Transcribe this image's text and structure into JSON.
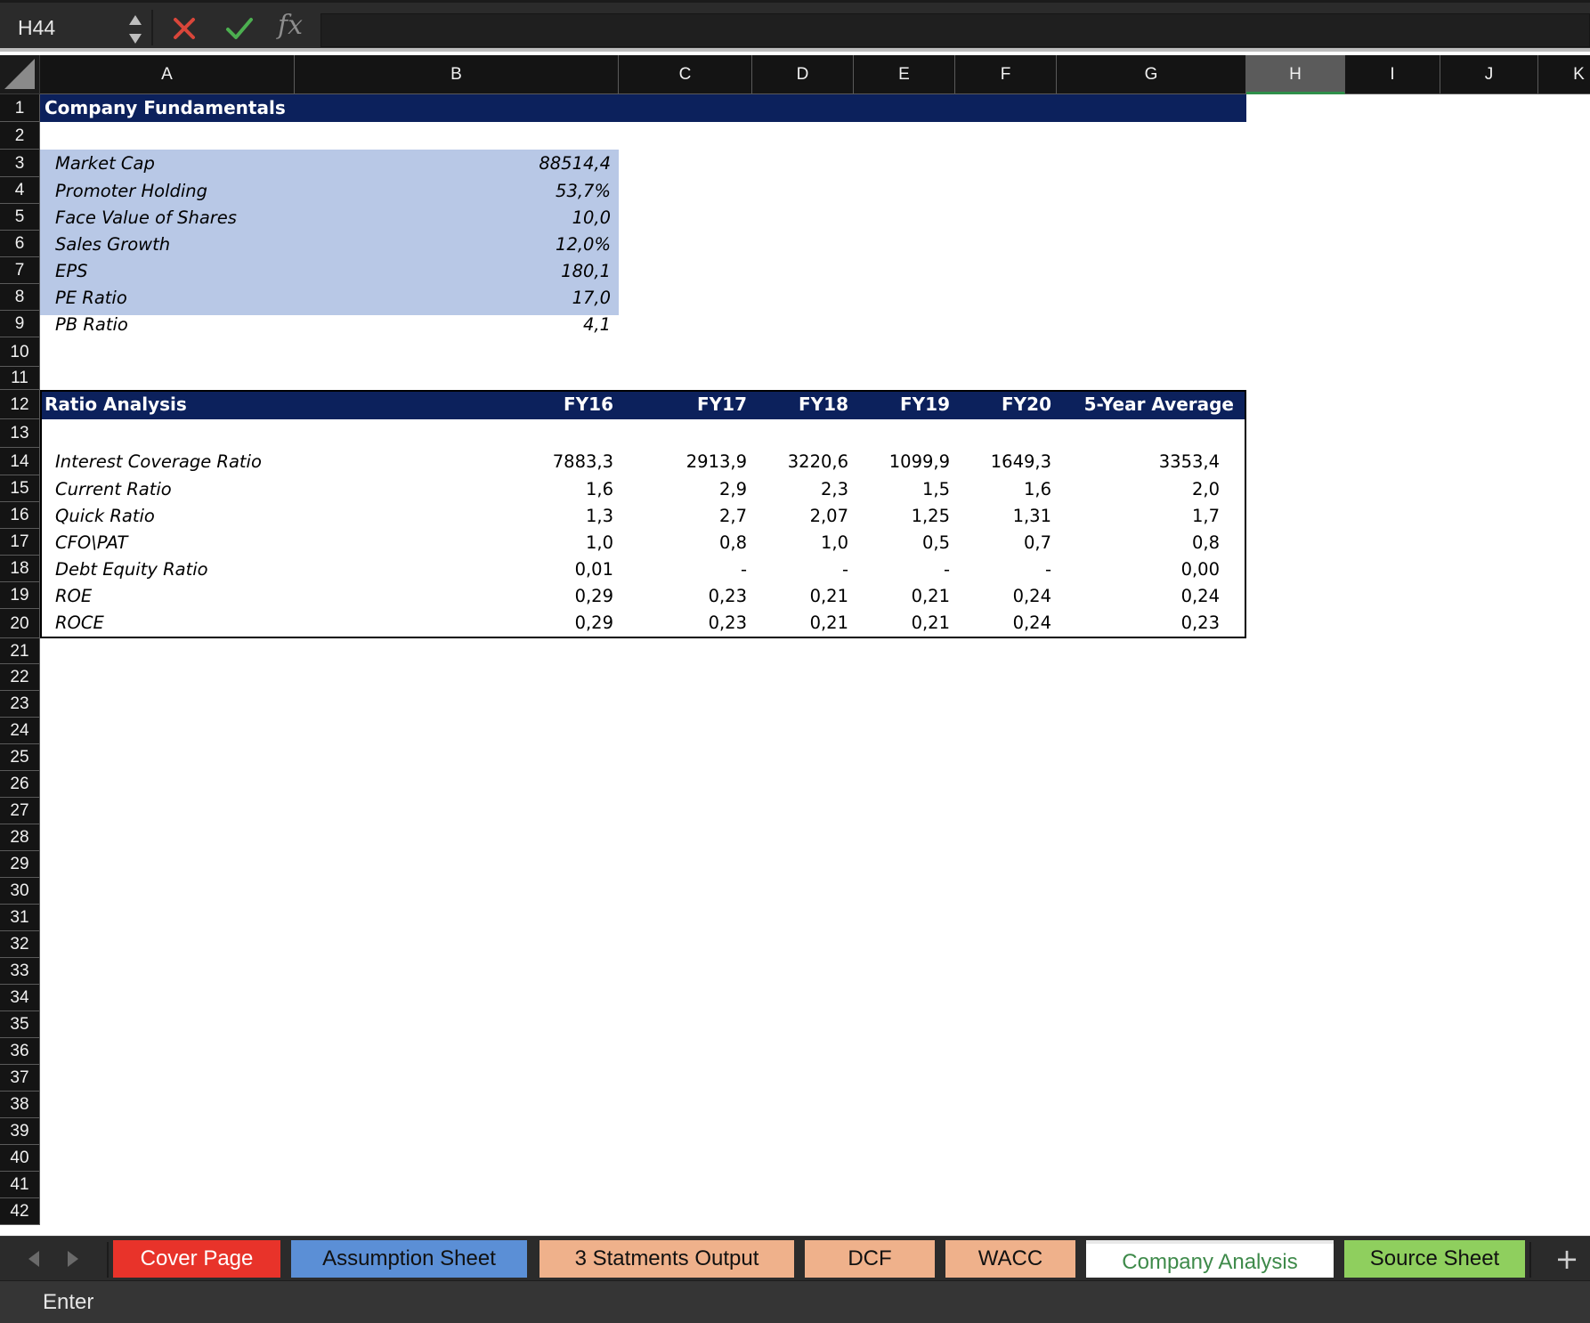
{
  "formula_bar": {
    "name_box": "H44",
    "formula": "",
    "fx_label": "fx"
  },
  "columns": [
    "A",
    "B",
    "C",
    "D",
    "E",
    "F",
    "G",
    "H",
    "I",
    "J",
    "K"
  ],
  "selected_column": "H",
  "rows": [
    "1",
    "2",
    "3",
    "4",
    "5",
    "6",
    "7",
    "8",
    "9",
    "10",
    "11",
    "12",
    "13",
    "14",
    "15",
    "16",
    "17",
    "18",
    "19",
    "20",
    "21",
    "22",
    "23",
    "24",
    "25",
    "26",
    "27",
    "28",
    "29",
    "30",
    "31",
    "32",
    "33",
    "34",
    "35",
    "36",
    "37",
    "38",
    "39",
    "40",
    "41",
    "42"
  ],
  "fundamentals": {
    "title": "Company Fundamentals",
    "items": [
      {
        "label": "Market Cap",
        "value": "88514,4"
      },
      {
        "label": "Promoter Holding",
        "value": "53,7%"
      },
      {
        "label": "Face Value of Shares",
        "value": "10,0"
      },
      {
        "label": "Sales Growth",
        "value": "12,0%"
      },
      {
        "label": "EPS",
        "value": "180,1"
      },
      {
        "label": "PE Ratio",
        "value": "17,0"
      },
      {
        "label": "PB Ratio",
        "value": "4,1"
      }
    ]
  },
  "ratio_analysis": {
    "title": "Ratio Analysis",
    "headers": [
      "FY16",
      "FY17",
      "FY18",
      "FY19",
      "FY20",
      "5-Year Average"
    ],
    "rows": [
      {
        "label": "Interest Coverage Ratio",
        "values": [
          "7883,3",
          "2913,9",
          "3220,6",
          "1099,9",
          "1649,3",
          "3353,4"
        ]
      },
      {
        "label": "Current Ratio",
        "values": [
          "1,6",
          "2,9",
          "2,3",
          "1,5",
          "1,6",
          "2,0"
        ]
      },
      {
        "label": "Quick Ratio",
        "values": [
          "1,3",
          "2,7",
          "2,07",
          "1,25",
          "1,31",
          "1,7"
        ]
      },
      {
        "label": "CFO\\PAT",
        "values": [
          "1,0",
          "0,8",
          "1,0",
          "0,5",
          "0,7",
          "0,8"
        ]
      },
      {
        "label": "Debt Equity Ratio",
        "values": [
          "0,01",
          "-",
          "-",
          "-",
          "-",
          "0,00"
        ]
      },
      {
        "label": "ROE",
        "values": [
          "0,29",
          "0,23",
          "0,21",
          "0,21",
          "0,24",
          "0,24"
        ]
      },
      {
        "label": "ROCE",
        "values": [
          "0,29",
          "0,23",
          "0,21",
          "0,21",
          "0,24",
          "0,23"
        ]
      }
    ]
  },
  "sheet_tabs": [
    {
      "label": "Cover Page",
      "bg": "#e8332a",
      "color": "#ffffff",
      "active": false
    },
    {
      "label": "Assumption Sheet",
      "bg": "#5b8fd6",
      "color": "#111111",
      "active": false
    },
    {
      "label": "3 Statments Output",
      "bg": "#efb18b",
      "color": "#111111",
      "active": false
    },
    {
      "label": "DCF",
      "bg": "#efb18b",
      "color": "#111111",
      "active": false
    },
    {
      "label": "WACC",
      "bg": "#efb18b",
      "color": "#111111",
      "active": false
    },
    {
      "label": "Company Analysis",
      "bg": "#ffffff",
      "color": "#3e8a4a",
      "active": true
    },
    {
      "label": "Source Sheet",
      "bg": "#8fcf5e",
      "color": "#111111",
      "active": false
    }
  ],
  "status_bar": {
    "mode": "Enter"
  },
  "colors": {
    "header_band": "#0c215c",
    "fundamentals_band": "#b8c8e6",
    "selected_column_accent": "#2f8f4a"
  }
}
